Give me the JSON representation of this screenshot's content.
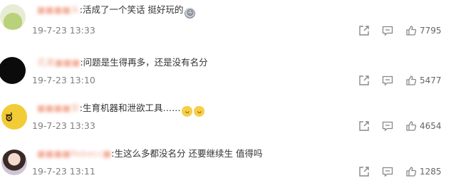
{
  "comments": [
    {
      "username": "■■■■头",
      "colon": ":",
      "text": "活成了一个笑话 挺好玩的",
      "emoji": "😂",
      "time": "19-7-23 13:33",
      "likes": "7795"
    },
    {
      "username": "花美■■■",
      "colon": ":",
      "text": "问题是生得再多，还是没有名分",
      "time": "19-7-23 13:10",
      "likes": "5477"
    },
    {
      "username": "■■■■安",
      "colon": ":",
      "text": "生育机器和泄欲工具……",
      "emoji": "🐱🐱",
      "time": "19-7-23 13:33",
      "likes": "4654"
    },
    {
      "username": "■■■■Rebecc■",
      "colon": ":",
      "text": "生这么多都没名分 还要继续生 值得吗",
      "time": "19-7-23 13:11",
      "likes": "1285"
    }
  ],
  "icons": {
    "share": "share-icon",
    "comment": "comment-icon",
    "like": "like-icon"
  },
  "colors": {
    "username": "#eb7350",
    "text": "#333333",
    "meta": "#808080",
    "icon": "#888888"
  }
}
